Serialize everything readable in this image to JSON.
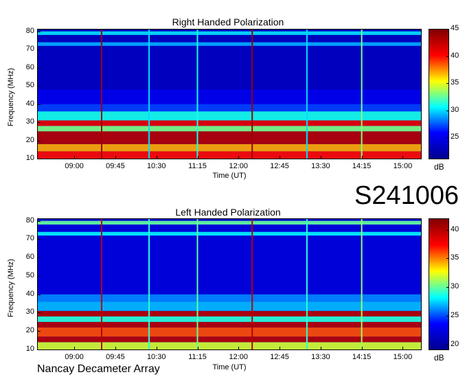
{
  "figure": {
    "event_id": "S241006",
    "footer": "Nancay Decameter Array"
  },
  "chart_data": [
    {
      "type": "heatmap",
      "title": "Right Handed Polarization",
      "xlabel": "Time (UT)",
      "ylabel": "Frequency (MHz)",
      "x_tick_labels": [
        "09:00",
        "09:45",
        "10:30",
        "11:15",
        "12:00",
        "12:45",
        "13:30",
        "14:15",
        "15:00"
      ],
      "x_range": [
        "08:20",
        "15:20"
      ],
      "y_ticks": [
        10,
        20,
        30,
        40,
        50,
        60,
        70,
        80
      ],
      "ylim": [
        10,
        81
      ],
      "colorbar": {
        "label": "dB",
        "ticks": [
          25,
          30,
          35,
          40,
          45
        ],
        "range": [
          21,
          45
        ]
      },
      "colormap": [
        "#00008f",
        "#0000ff",
        "#00ffff",
        "#ffff00",
        "#ff0000",
        "#800000"
      ],
      "background_level_db": 23,
      "frequency_bands": [
        {
          "from": 10,
          "to": 14,
          "db": 40
        },
        {
          "from": 14,
          "to": 18,
          "db": 37
        },
        {
          "from": 18,
          "to": 25,
          "db": 43
        },
        {
          "from": 25,
          "to": 28,
          "db": 33
        },
        {
          "from": 28,
          "to": 31,
          "db": 41
        },
        {
          "from": 31,
          "to": 36,
          "db": 31
        },
        {
          "from": 36,
          "to": 40,
          "db": 27
        },
        {
          "from": 40,
          "to": 48,
          "db": 25
        },
        {
          "from": 72,
          "to": 74,
          "db": 29
        },
        {
          "from": 78,
          "to": 80,
          "db": 30
        }
      ],
      "vertical_events": [
        {
          "time": "09:30",
          "db": 44
        },
        {
          "time": "10:22",
          "db": 30
        },
        {
          "time": "11:15",
          "db": 31
        },
        {
          "time": "12:15",
          "db": 44
        },
        {
          "time": "13:15",
          "db": 30
        },
        {
          "time": "14:15",
          "db": 33
        }
      ]
    },
    {
      "type": "heatmap",
      "title": "Left Handed Polarization",
      "xlabel": "Time (UT)",
      "ylabel": "Frequency (MHz)",
      "x_tick_labels": [
        "09:00",
        "09:45",
        "10:30",
        "11:15",
        "12:00",
        "12:45",
        "13:30",
        "14:15",
        "15:00"
      ],
      "x_range": [
        "08:20",
        "15:20"
      ],
      "y_ticks": [
        10,
        20,
        30,
        40,
        50,
        60,
        70,
        80
      ],
      "ylim": [
        10,
        81
      ],
      "colorbar": {
        "label": "dB",
        "ticks": [
          20,
          25,
          30,
          35,
          40
        ],
        "range": [
          19,
          42
        ]
      },
      "colormap": [
        "#00008f",
        "#0000ff",
        "#00ffff",
        "#ffff00",
        "#ff0000",
        "#800000"
      ],
      "background_level_db": 22,
      "frequency_bands": [
        {
          "from": 10,
          "to": 14,
          "db": 32
        },
        {
          "from": 14,
          "to": 17,
          "db": 40
        },
        {
          "from": 17,
          "to": 22,
          "db": 36
        },
        {
          "from": 22,
          "to": 25,
          "db": 40
        },
        {
          "from": 25,
          "to": 28,
          "db": 29
        },
        {
          "from": 28,
          "to": 31,
          "db": 40
        },
        {
          "from": 31,
          "to": 36,
          "db": 27
        },
        {
          "from": 36,
          "to": 40,
          "db": 26
        },
        {
          "from": 72,
          "to": 74,
          "db": 28
        },
        {
          "from": 78,
          "to": 80,
          "db": 30
        }
      ],
      "vertical_events": [
        {
          "time": "09:30",
          "db": 40
        },
        {
          "time": "10:22",
          "db": 29
        },
        {
          "time": "11:15",
          "db": 30
        },
        {
          "time": "12:15",
          "db": 40
        },
        {
          "time": "13:15",
          "db": 29
        },
        {
          "time": "14:15",
          "db": 31
        }
      ]
    }
  ]
}
